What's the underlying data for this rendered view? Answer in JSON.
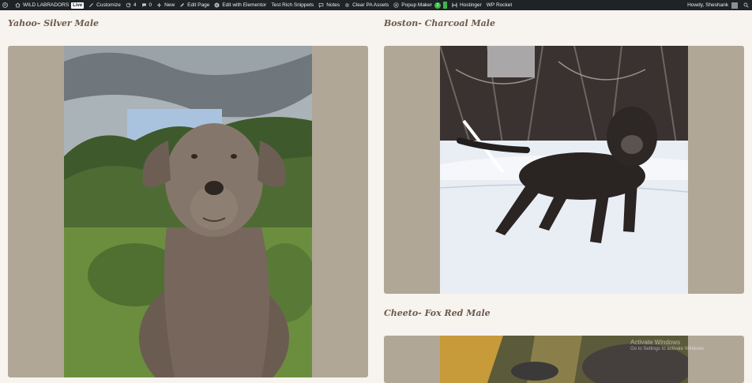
{
  "adminbar": {
    "site_name": "WILD LABRADORS",
    "live_badge": "Live",
    "customize": "Customize",
    "updates_count": "4",
    "comments_count": "0",
    "new": "New",
    "edit_page": "Edit Page",
    "edit_elementor": "Edit with Elementor",
    "rich_snippets": "Test Rich Snippets",
    "notes": "Notes",
    "clear_assets": "Clear PA Assets",
    "popup_maker": "Popup Maker",
    "popup_count": "2",
    "hostinger": "Hostinger",
    "wp_rocket": "WP Rocket",
    "howdy": "Howdy, Sheshank"
  },
  "dogs": [
    {
      "title": "Yahoo- Silver Male"
    },
    {
      "title": "Boston- Charcoal Male"
    },
    {
      "title": "Cheeto- Fox Red Male"
    }
  ],
  "watermark": {
    "line1": "Activate Windows",
    "line2": "Go to Settings to activate Windows."
  },
  "colors": {
    "page_bg": "#f7f3ee",
    "card_bg": "#b0a796",
    "heading": "#6c5a4e",
    "adminbar": "#1d2327"
  }
}
